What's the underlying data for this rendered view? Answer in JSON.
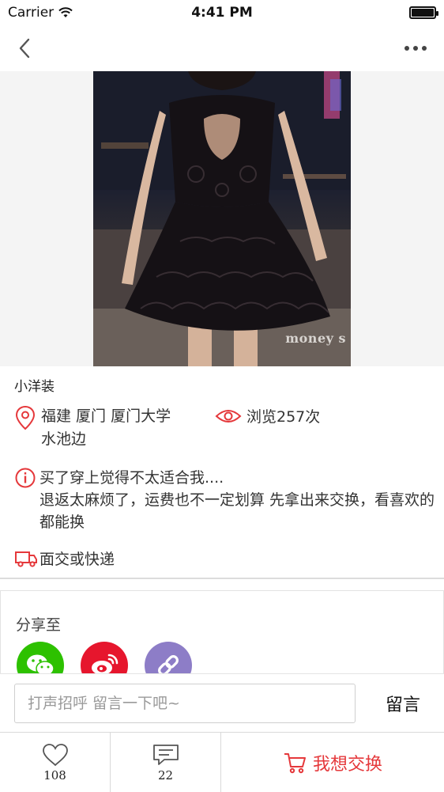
{
  "status_bar": {
    "carrier": "Carrier",
    "time": "4:41 PM"
  },
  "nav": {
    "back_icon": "chevron-left-icon",
    "more_icon": "more-horizontal-icon"
  },
  "item": {
    "title": "小洋装",
    "location": "福建 厦门 厦门大学 水池边",
    "views": "浏览257次",
    "description_line1": "买了穿上觉得不太适合我....",
    "description_line2": "退返太麻烦了，运费也不一定划算 先拿出来交换，看喜欢的都能换",
    "delivery": "面交或快递",
    "photo_watermark": "money s"
  },
  "share": {
    "label": "分享至",
    "targets": [
      {
        "name": "wechat",
        "icon": "wechat-icon",
        "color": "#2dc100"
      },
      {
        "name": "weibo",
        "icon": "weibo-icon",
        "color": "#e6162d"
      },
      {
        "name": "link",
        "icon": "link-icon",
        "color": "#8d7dc7"
      }
    ]
  },
  "comment": {
    "placeholder": "打声招呼 留言一下吧~",
    "submit_label": "留言"
  },
  "actions": {
    "like_count": "108",
    "comment_count": "22",
    "exchange_label": "我想交换"
  },
  "colors": {
    "accent": "#e5383b",
    "icon_red": "#e5383b"
  }
}
